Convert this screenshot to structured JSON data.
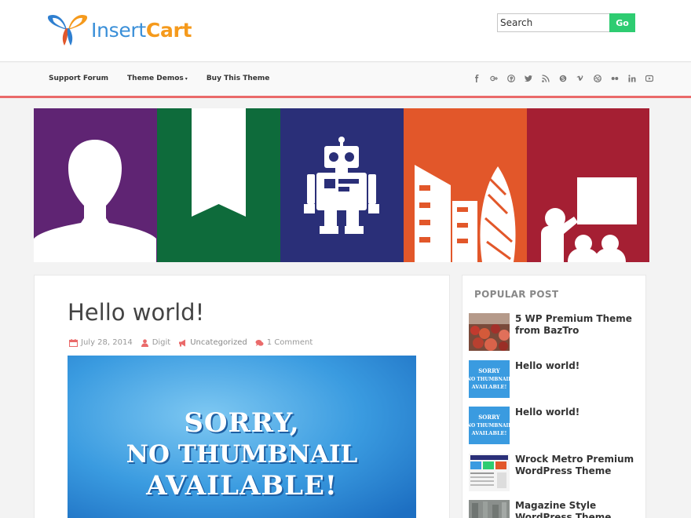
{
  "header": {
    "logo_text_1": "Insert",
    "logo_text_2": "Cart",
    "search_placeholder": "Search",
    "search_button": "Go"
  },
  "nav": {
    "items": [
      {
        "label": "Support Forum"
      },
      {
        "label": "Theme Demos",
        "has_dropdown": true
      },
      {
        "label": "Buy This Theme"
      }
    ],
    "dropdown_caret": "▾",
    "social_icons": [
      "facebook-icon",
      "google-plus-icon",
      "pinterest-icon",
      "twitter-icon",
      "rss-icon",
      "skype-icon",
      "vimeo-icon",
      "dribbble-icon",
      "flickr-icon",
      "linkedin-icon",
      "youtube-icon"
    ],
    "accent_line_color": "#ea6a6a"
  },
  "banner": {
    "panels": [
      {
        "name": "person",
        "color": "#5f2473"
      },
      {
        "name": "bookmark",
        "color": "#0e6b3b"
      },
      {
        "name": "robot",
        "color": "#2a2f78"
      },
      {
        "name": "buildings",
        "color": "#e2572a"
      },
      {
        "name": "presentation",
        "color": "#a51f33"
      }
    ]
  },
  "post": {
    "title": "Hello world!",
    "date": "July 28, 2014",
    "author": "Digit",
    "category": "Uncategorized",
    "comments": "1 Comment",
    "thumbnail_line1": "SORRY,",
    "thumbnail_line2": "NO THUMBNAIL",
    "thumbnail_line3": "AVAILABLE!"
  },
  "sidebar": {
    "title": "POPULAR POST",
    "posts": [
      {
        "title": "5 WP Premium Theme from BazTro",
        "thumb": "crowd-photo"
      },
      {
        "title": "Hello world!",
        "thumb": "no-thumbnail"
      },
      {
        "title": "Hello world!",
        "thumb": "no-thumbnail"
      },
      {
        "title": "Wrock Metro Premium WordPress Theme",
        "thumb": "theme-screenshot"
      },
      {
        "title": "Magazine Style WordPress Theme",
        "thumb": "gray-photo"
      }
    ]
  },
  "colors": {
    "go_button": "#2ecc71",
    "meta_icon": "#ea6a6a"
  }
}
